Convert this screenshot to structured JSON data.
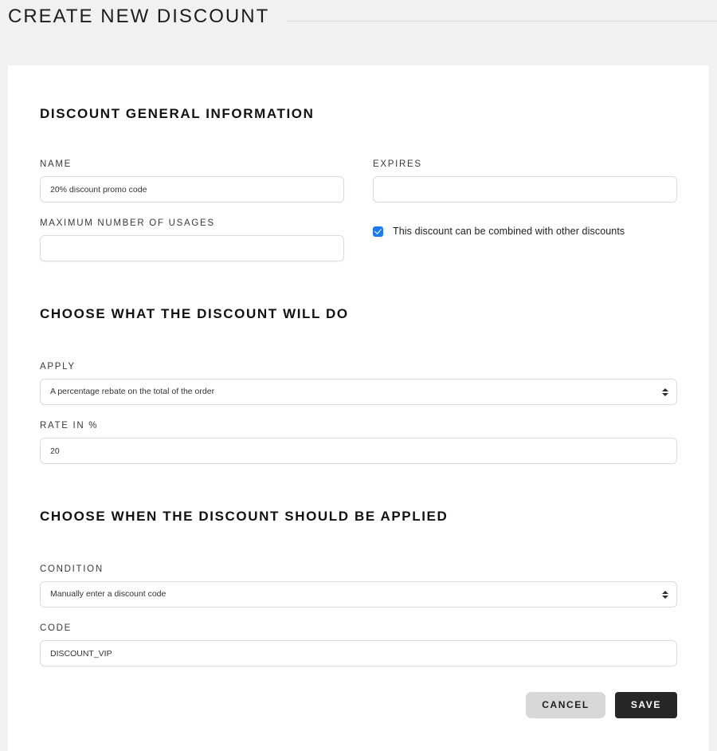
{
  "header": {
    "title": "CREATE NEW DISCOUNT"
  },
  "sections": {
    "general": {
      "title": "DISCOUNT GENERAL INFORMATION",
      "name": {
        "label": "NAME",
        "value": "20% discount promo code",
        "placeholder": ""
      },
      "expires": {
        "label": "EXPIRES",
        "value": "",
        "placeholder": ""
      },
      "max_usages": {
        "label": "MAXIMUM NUMBER OF USAGES",
        "value": "",
        "placeholder": ""
      },
      "combinable": {
        "label": "This discount can be combined with other discounts",
        "checked": true
      }
    },
    "what": {
      "title": "CHOOSE WHAT THE DISCOUNT WILL DO",
      "apply": {
        "label": "APPLY",
        "value": "A percentage rebate on the total of the order"
      },
      "rate": {
        "label": "RATE IN %",
        "value": "20",
        "placeholder": ""
      }
    },
    "when": {
      "title": "CHOOSE WHEN THE DISCOUNT SHOULD BE APPLIED",
      "condition": {
        "label": "CONDITION",
        "value": "Manually enter a discount code"
      },
      "code": {
        "label": "CODE",
        "value": "DISCOUNT_VIP",
        "placeholder": ""
      }
    }
  },
  "actions": {
    "cancel_label": "CANCEL",
    "save_label": "SAVE"
  },
  "colors": {
    "page_background": "#f1f1f1",
    "card_background": "#ffffff",
    "checkbox_accent": "#1a7bf2",
    "save_button": "#262626",
    "cancel_button": "#d8d8d8",
    "input_border": "#dcdcdc"
  }
}
